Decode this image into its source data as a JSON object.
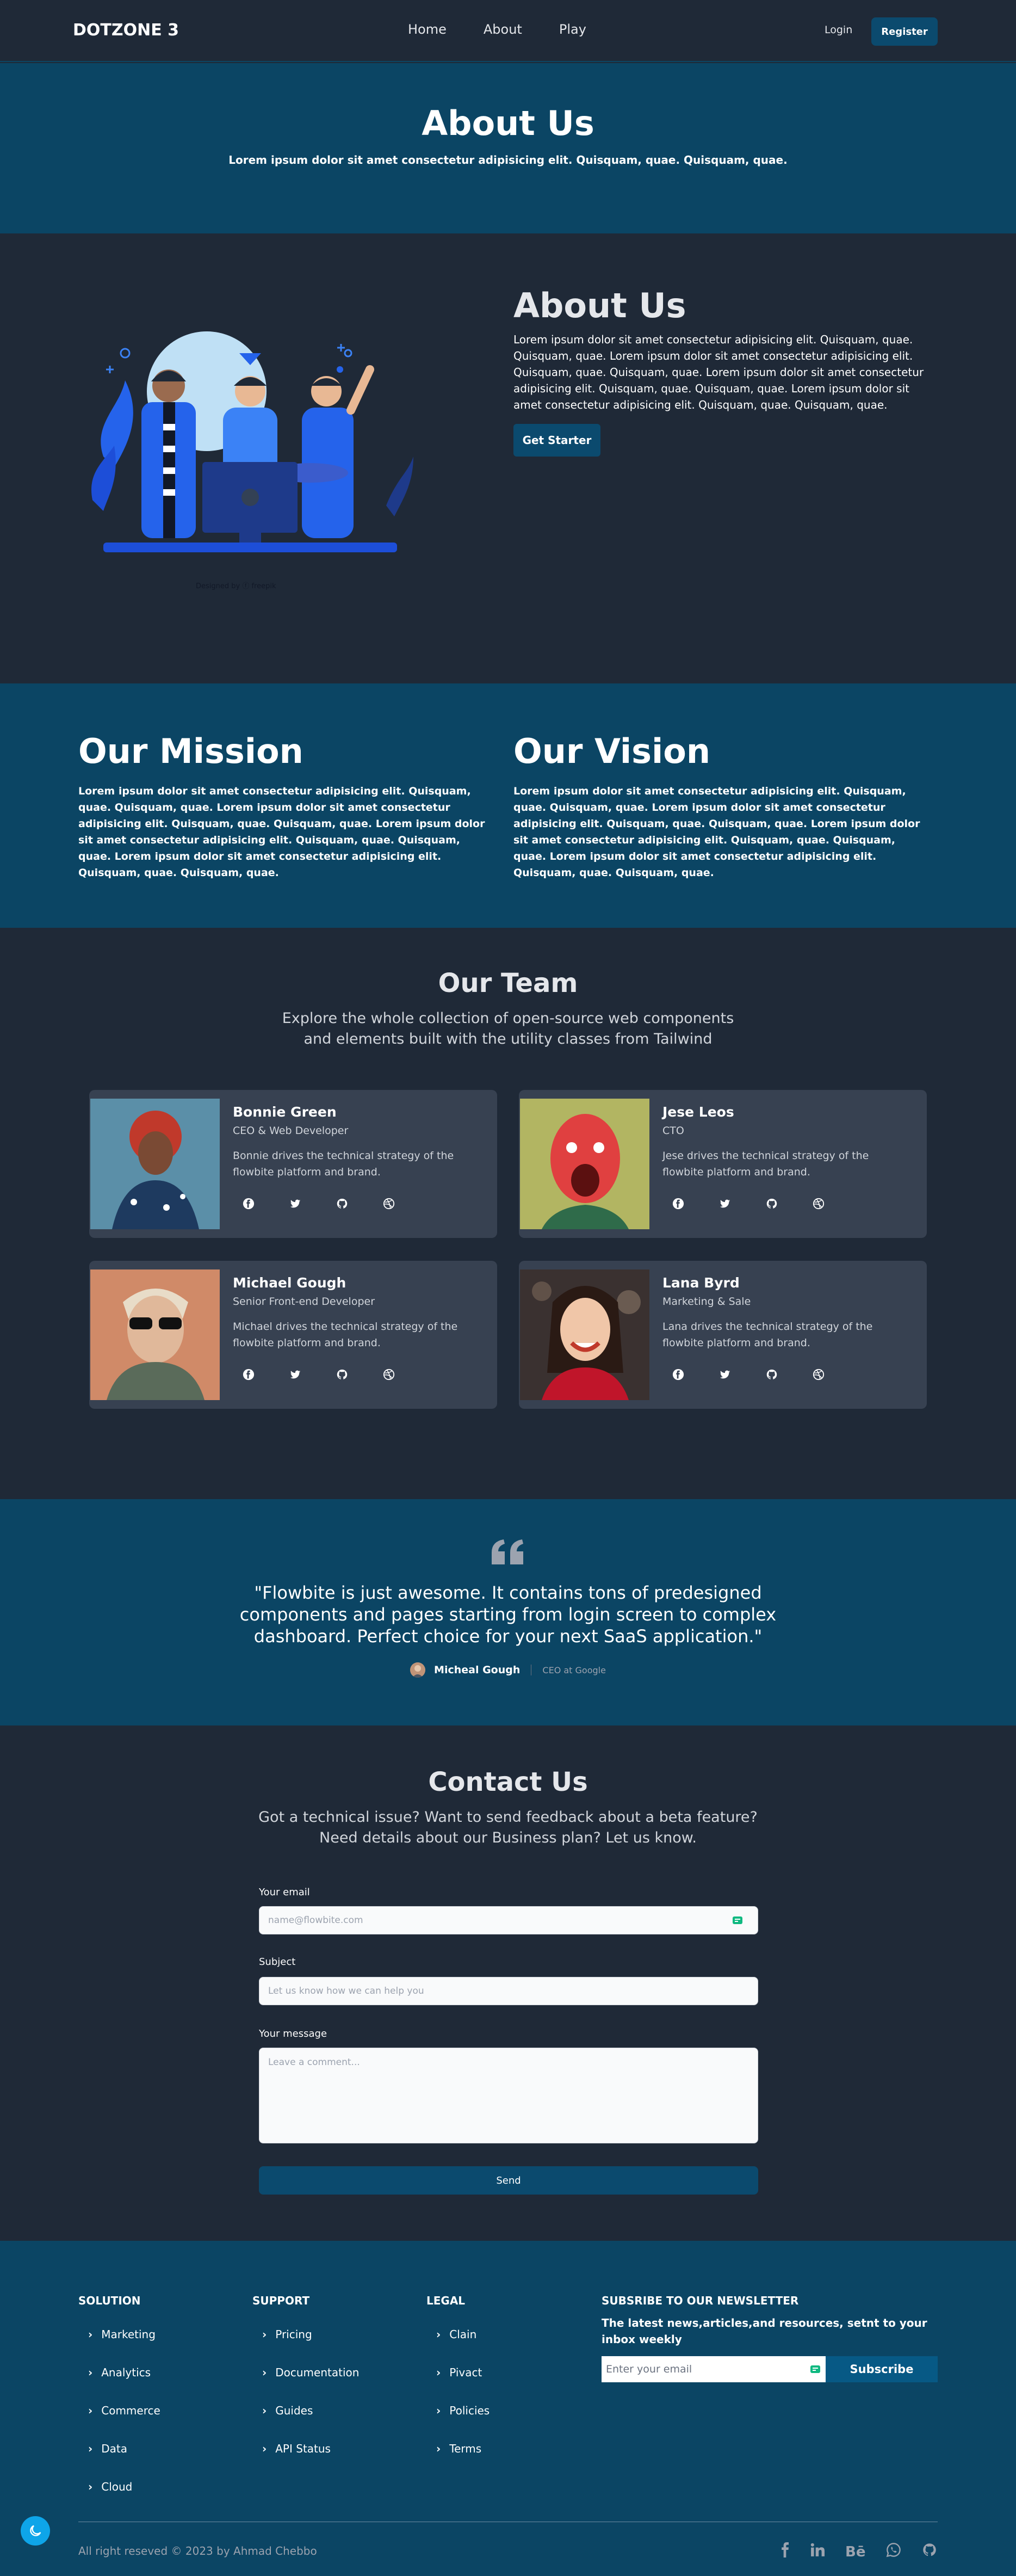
{
  "nav": {
    "logo": "DOTZONE 3",
    "links": [
      "Home",
      "About",
      "Play"
    ],
    "login": "Login",
    "register": "Register"
  },
  "hero": {
    "title": "About Us",
    "subtitle": "Lorem ipsum dolor sit amet consectetur adipisicing elit. Quisquam, quae. Quisquam, quae."
  },
  "about": {
    "title": "About Us",
    "text": "Lorem ipsum dolor sit amet consectetur adipisicing elit. Quisquam, quae. Quisquam, quae. Lorem ipsum dolor sit amet consectetur adipisicing elit. Quisquam, quae. Quisquam, quae. Lorem ipsum dolor sit amet consectetur adipisicing elit. Quisquam, quae. Quisquam, quae. Lorem ipsum dolor sit amet consectetur adipisicing elit. Quisquam, quae. Quisquam, quae.",
    "button": "Get Starter",
    "credit": "Designed by",
    "credit_brand": "freepik"
  },
  "mission": {
    "title": "Our Mission",
    "text": "Lorem ipsum dolor sit amet consectetur adipisicing elit. Quisquam, quae. Quisquam, quae. Lorem ipsum dolor sit amet consectetur adipisicing elit. Quisquam, quae. Quisquam, quae. Lorem ipsum dolor sit amet consectetur adipisicing elit. Quisquam, quae. Quisquam, quae. Lorem ipsum dolor sit amet consectetur adipisicing elit. Quisquam, quae. Quisquam, quae."
  },
  "vision": {
    "title": "Our Vision",
    "text": "Lorem ipsum dolor sit amet consectetur adipisicing elit. Quisquam, quae. Quisquam, quae. Lorem ipsum dolor sit amet consectetur adipisicing elit. Quisquam, quae. Quisquam, quae. Lorem ipsum dolor sit amet consectetur adipisicing elit. Quisquam, quae. Quisquam, quae. Lorem ipsum dolor sit amet consectetur adipisicing elit. Quisquam, quae. Quisquam, quae."
  },
  "team": {
    "title": "Our Team",
    "subtitle_line1": "Explore the whole collection of open-source web components",
    "subtitle_line2": "and elements built with the utility classes from Tailwind",
    "members": [
      {
        "name": "Bonnie Green",
        "role": "CEO & Web Developer",
        "bio": "Bonnie drives the technical strategy of the flowbite platform and brand."
      },
      {
        "name": "Jese Leos",
        "role": "CTO",
        "bio": "Jese drives the technical strategy of the flowbite platform and brand."
      },
      {
        "name": "Michael Gough",
        "role": "Senior Front-end Developer",
        "bio": "Michael drives the technical strategy of the flowbite platform and brand."
      },
      {
        "name": "Lana Byrd",
        "role": "Marketing & Sale",
        "bio": "Lana drives the technical strategy of the flowbite platform and brand."
      }
    ],
    "social_icons": [
      "facebook-icon",
      "twitter-icon",
      "github-icon",
      "dribbble-icon"
    ]
  },
  "testimonial": {
    "quote": "\"Flowbite is just awesome. It contains tons of predesigned components and pages starting from login screen to complex dashboard. Perfect choice for your next SaaS application.\"",
    "author": "Micheal Gough",
    "role": "CEO at Google"
  },
  "contact": {
    "title": "Contact Us",
    "subtitle_line1": "Got a technical issue? Want to send feedback about a beta feature?",
    "subtitle_line2": "Need details about our Business plan? Let us know.",
    "email_label": "Your email",
    "email_placeholder": "name@flowbite.com",
    "subject_label": "Subject",
    "subject_placeholder": "Let us know how we can help you",
    "message_label": "Your message",
    "message_placeholder": "Leave a comment...",
    "send": "Send"
  },
  "footer": {
    "solution": {
      "title": "SOLUTION",
      "items": [
        "Marketing",
        "Analytics",
        "Commerce",
        "Data",
        "Cloud"
      ]
    },
    "support": {
      "title": "SUPPORT",
      "items": [
        "Pricing",
        "Documentation",
        "Guides",
        "API Status"
      ]
    },
    "legal": {
      "title": "LEGAL",
      "items": [
        "Clain",
        "Pivact",
        "Policies",
        "Terms"
      ]
    },
    "newsletter": {
      "title": "SUBSRIBE TO OUR NEWSLETTER",
      "text": "The latest news,articles,and resources, setnt to your inbox weekly",
      "placeholder": "Enter your email",
      "button": "Subscribe"
    },
    "copyright": "All right reseved © 2023 by Ahmad Chebbo",
    "social_icons": [
      "facebook-icon",
      "linkedin-icon",
      "behance-icon",
      "whatsapp-icon",
      "github-icon"
    ],
    "behance_text": "Bē"
  },
  "colors": {
    "dark_bg": "#1f2937",
    "brand_blue": "#0b4564",
    "card_bg": "#374151",
    "button_blue": "#0b4a6e",
    "toggle_blue": "#0ea5e9"
  }
}
